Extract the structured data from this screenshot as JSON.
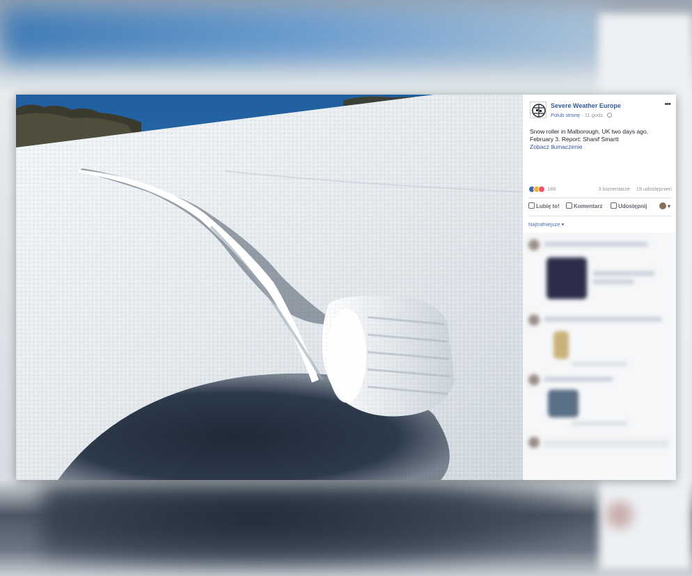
{
  "post": {
    "page_name": "Severe Weather Europe",
    "like_page": "Polub stronę",
    "time": "11 godz.",
    "more": "•••",
    "text": "Snow roller in Malborough, UK two days ago, February 3. Report: Shanif Smartt",
    "translate": "Zobacz tłumaczenie"
  },
  "stats": {
    "reactions": "186",
    "comments": "3 komentarze",
    "shares": "19 udostępnień"
  },
  "actions": {
    "like": "Lubię to!",
    "comment": "Komentarz",
    "share": "Udostępnij"
  },
  "comments": {
    "sort": "Najtrafniejsze ▾"
  },
  "colors": {
    "link_blue": "#365899",
    "like_blue": "#4267b2",
    "sky": "#2f73b8",
    "snow": "#eef2f5"
  }
}
